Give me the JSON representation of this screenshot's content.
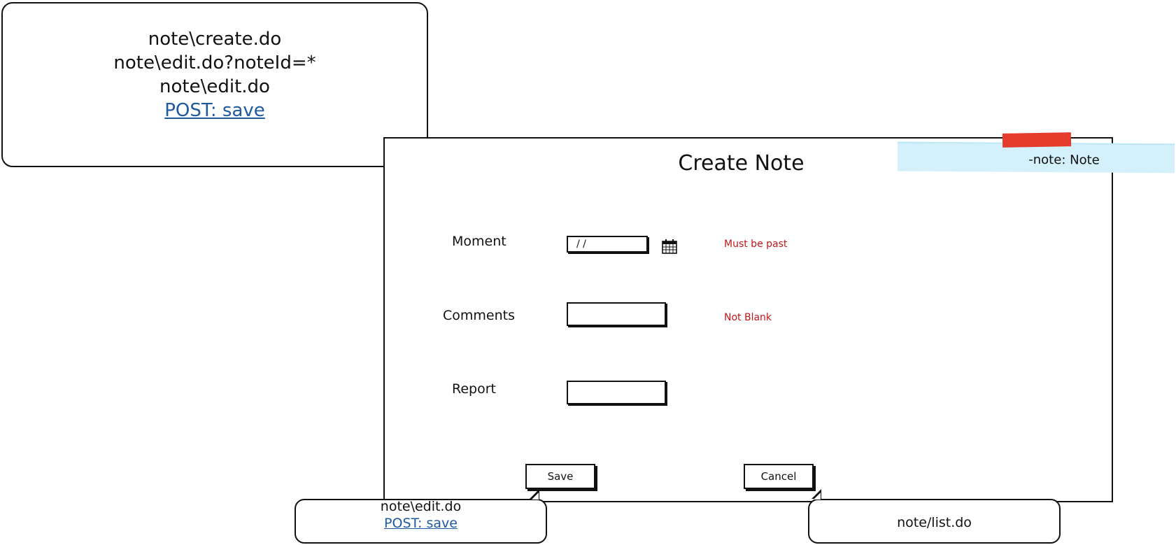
{
  "top_bubble": {
    "lines": [
      "note\\create.do",
      "note\\edit.do?noteId=*",
      "note\\edit.do"
    ],
    "link": "POST: save"
  },
  "window": {
    "title": "Create Note",
    "sticky_note": "-note: Note"
  },
  "form": {
    "moment": {
      "label": "Moment",
      "value": "/ /",
      "error": "Must be past",
      "icon": "calendar-icon"
    },
    "comments": {
      "label": "Comments",
      "value": "",
      "error": "Not Blank"
    },
    "report": {
      "label": "Report",
      "value": ""
    }
  },
  "buttons": {
    "save": "Save",
    "cancel": "Cancel"
  },
  "bottom_left_bubble": {
    "line": "note\\edit.do",
    "link": "POST: save"
  },
  "bottom_right_bubble": {
    "line": "note/list.do"
  },
  "colors": {
    "error": "#c0161a",
    "link": "#1f5aa0",
    "sticky_bg": "#d4f1fb",
    "tape": "#e43b2c"
  }
}
